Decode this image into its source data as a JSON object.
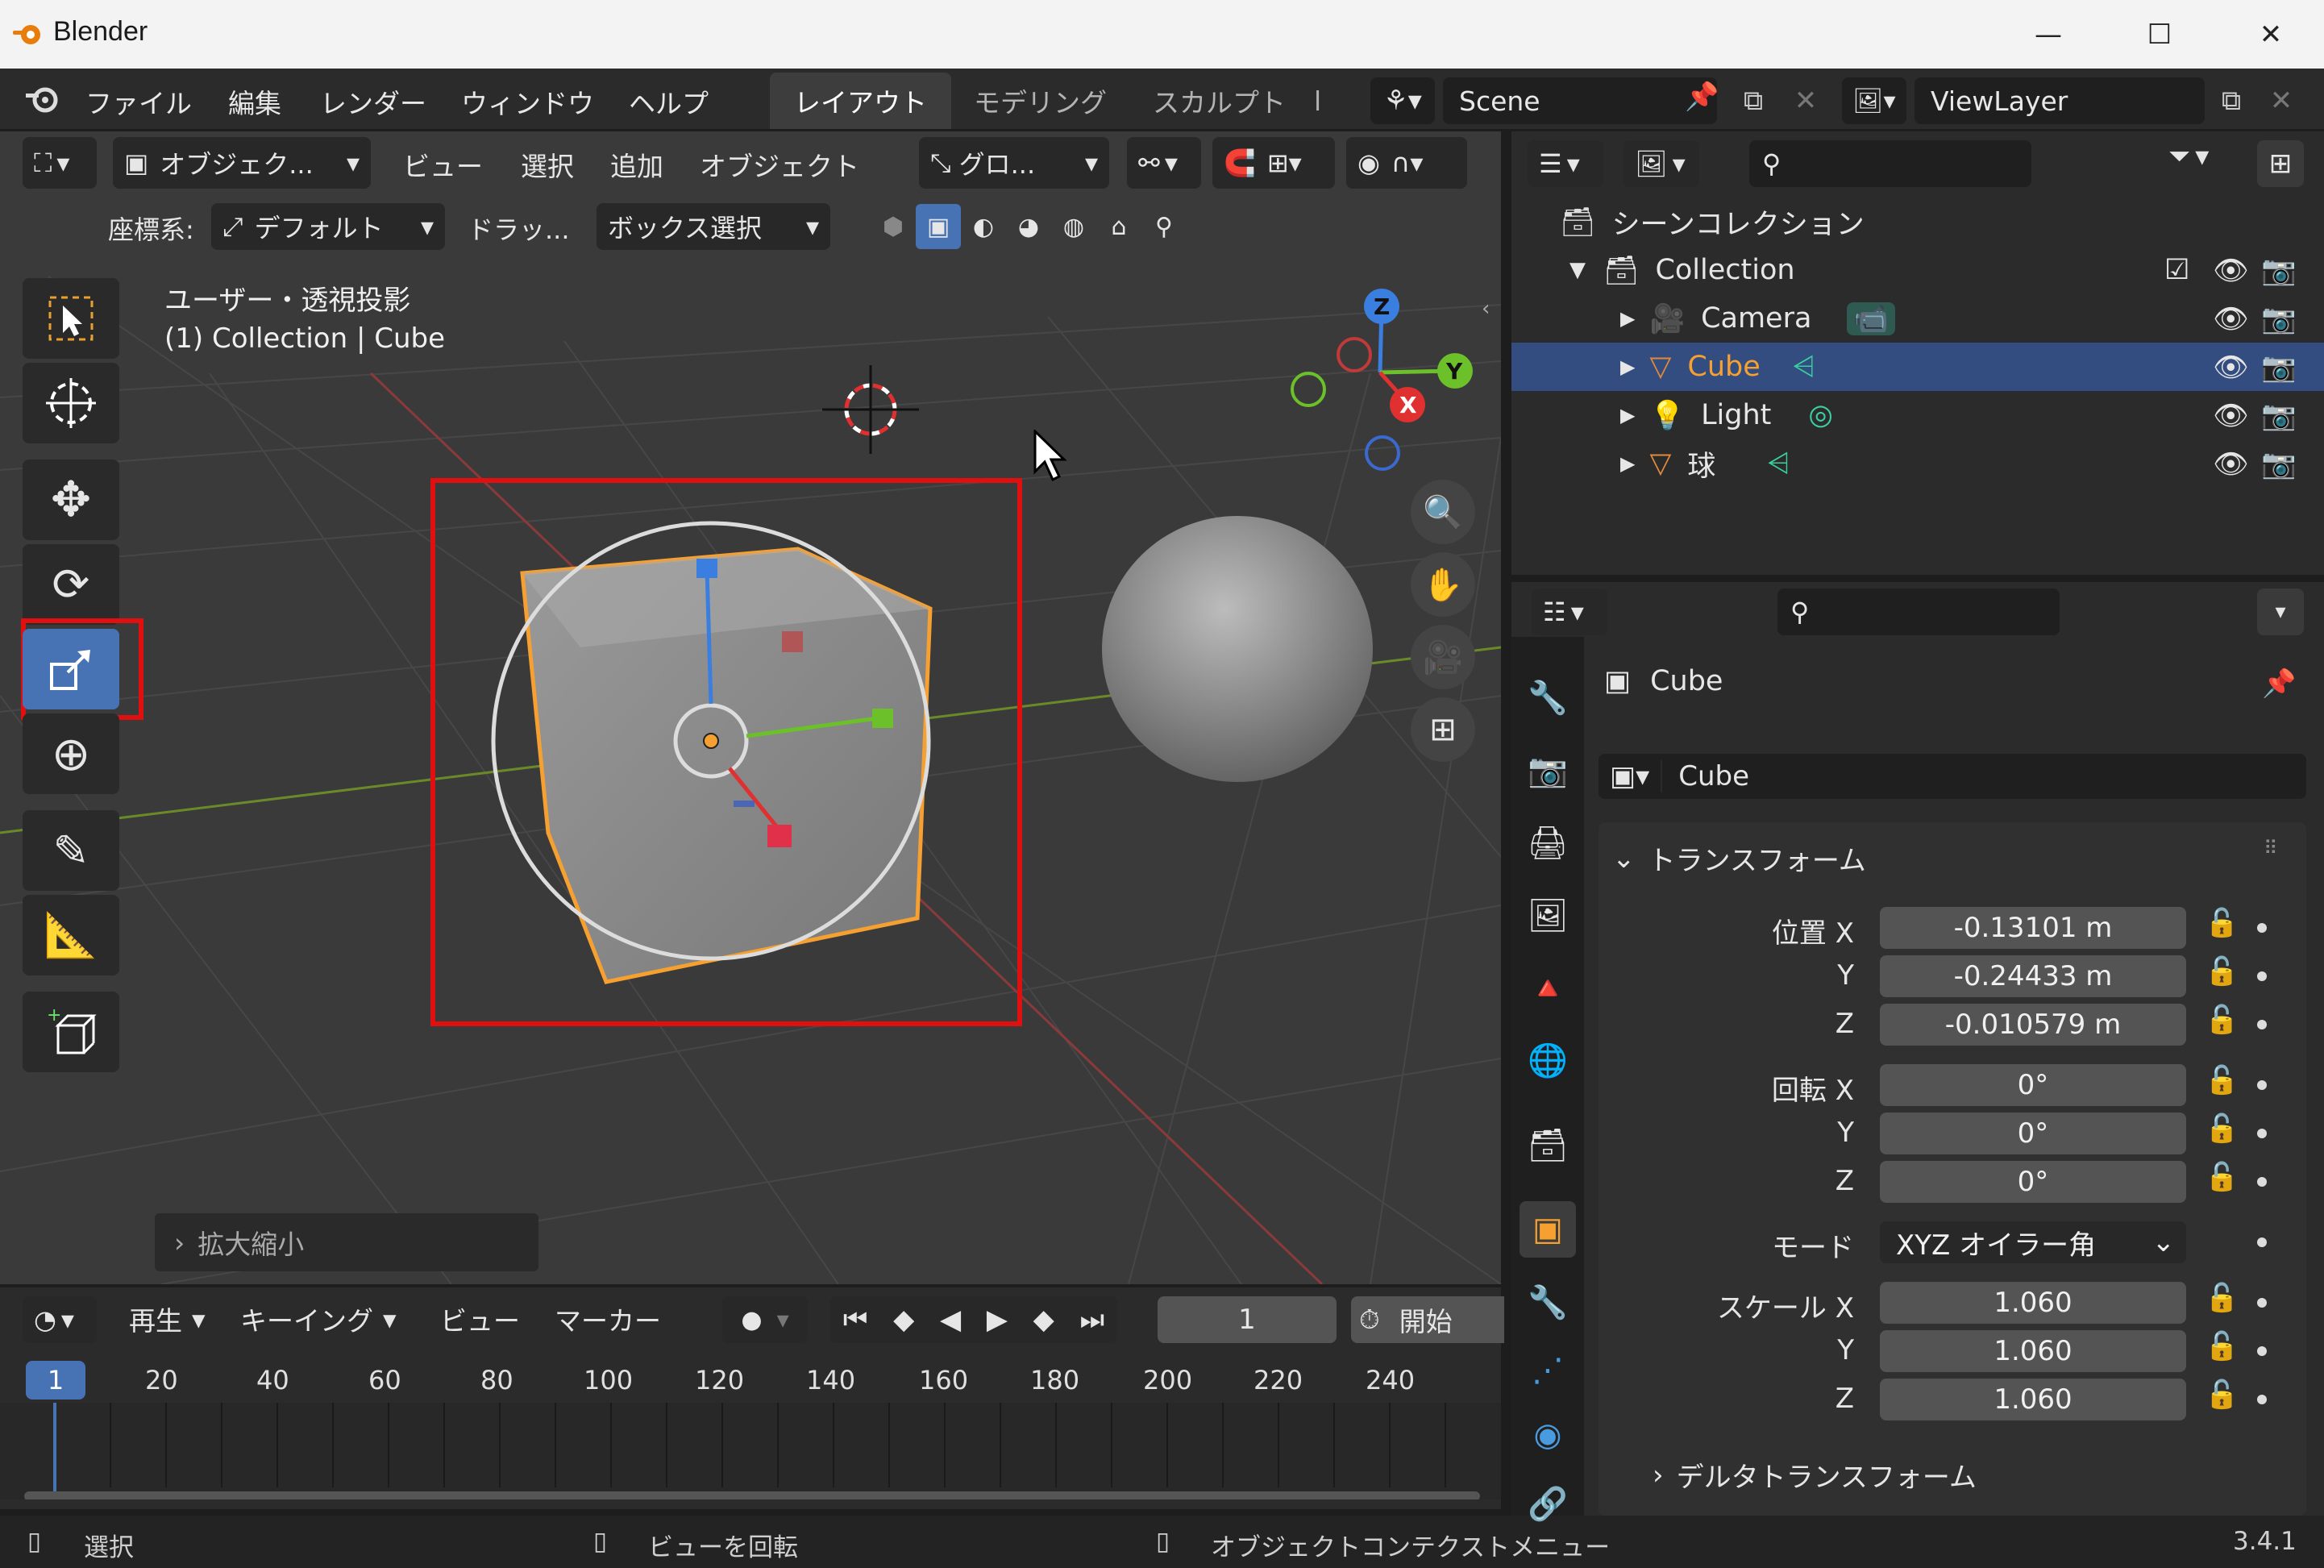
{
  "window": {
    "title": "Blender",
    "minimize": "—",
    "maximize": "☐",
    "close": "✕"
  },
  "menubar": {
    "items": [
      "ファイル",
      "編集",
      "レンダー",
      "ウィンドウ",
      "ヘルプ"
    ],
    "workspaces": [
      "レイアウト",
      "モデリング",
      "スカルプト",
      "l"
    ],
    "scene": "Scene",
    "view_layer": "ViewLayer"
  },
  "viewport_header": {
    "mode": "オブジェク...",
    "menus": [
      "ビュー",
      "選択",
      "追加",
      "オブジェクト"
    ],
    "transform_orientation": "グロ...",
    "coord_label": "座標系:",
    "coord_value": "デフォルト",
    "drag_label": "ドラッ...",
    "drag_value": "ボックス選択"
  },
  "viewport": {
    "view_name": "ユーザー・透視投影",
    "context": "(1) Collection | Cube",
    "last_op": "拡大縮小",
    "gizmo": {
      "z": "Z",
      "y": "Y",
      "x": "X"
    }
  },
  "timeline": {
    "menus": [
      "再生",
      "キーイング",
      "ビュー",
      "マーカー"
    ],
    "current_frame": "1",
    "start_label": "開始",
    "ruler": [
      "1",
      "20",
      "40",
      "60",
      "80",
      "100",
      "120",
      "140",
      "160",
      "180",
      "200",
      "220",
      "240"
    ]
  },
  "status": {
    "left": "選択",
    "middle": "ビューを回転",
    "right": "オブジェクトコンテクストメニュー",
    "version": "3.4.1"
  },
  "outliner": {
    "root": "シーンコレクション",
    "collection": "Collection",
    "items": [
      {
        "name": "Camera",
        "icon": "camera-icon",
        "color": "#e08a3c"
      },
      {
        "name": "Cube",
        "icon": "mesh-icon",
        "color": "#e08a3c"
      },
      {
        "name": "Light",
        "icon": "light-icon",
        "color": "#e08a3c"
      },
      {
        "name": "球",
        "icon": "mesh-icon",
        "color": "#e08a3c"
      }
    ]
  },
  "properties": {
    "object_name": "Cube",
    "object_field": "Cube",
    "section": "トランスフォーム",
    "location_label": "位置 X",
    "rotation_label": "回転 X",
    "scale_label": "スケール X",
    "y_label": "Y",
    "z_label": "Z",
    "location": [
      "-0.13101 m",
      "-0.24433 m",
      "-0.010579 m"
    ],
    "rotation": [
      "0°",
      "0°",
      "0°"
    ],
    "mode_label": "モード",
    "mode_value": "XYZ オイラー角",
    "scale": [
      "1.060",
      "1.060",
      "1.060"
    ],
    "delta": "デルタトランスフォーム"
  },
  "colors": {
    "accent": "#4772b3",
    "selection_orange": "#f5a030",
    "highlight_red": "#e01010"
  }
}
